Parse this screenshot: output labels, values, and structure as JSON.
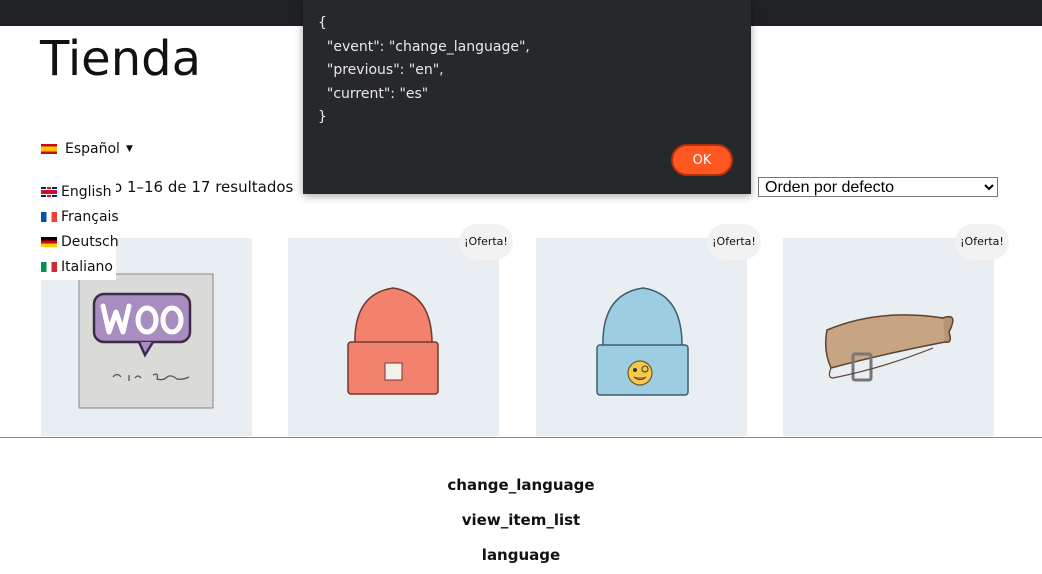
{
  "page": {
    "title": "Tienda"
  },
  "language_switcher": {
    "current": "Español",
    "options": [
      "English",
      "Français",
      "Deutsch",
      "Italiano"
    ]
  },
  "shop": {
    "results_count": "o 1–16 de 17 resultados",
    "orderby_selected": "Orden por defecto",
    "sale_label": "¡Oferta!"
  },
  "products": [
    {
      "image": "woo-album-image",
      "on_sale": false
    },
    {
      "image": "orange-beanie-image",
      "on_sale": true
    },
    {
      "image": "blue-beanie-image",
      "on_sale": true
    },
    {
      "image": "leather-belt-image",
      "on_sale": true
    }
  ],
  "events": [
    "change_language",
    "view_item_list",
    "language"
  ],
  "dialog": {
    "message": "{\n  \"event\": \"change_language\",\n  \"previous\": \"en\",\n  \"current\": \"es\"\n}",
    "ok_label": "OK"
  },
  "colors": {
    "topbar": "#1f2124",
    "dialog_bg": "#26282b",
    "ok_button": "#ff5722",
    "product_bg": "#e9eef2"
  }
}
